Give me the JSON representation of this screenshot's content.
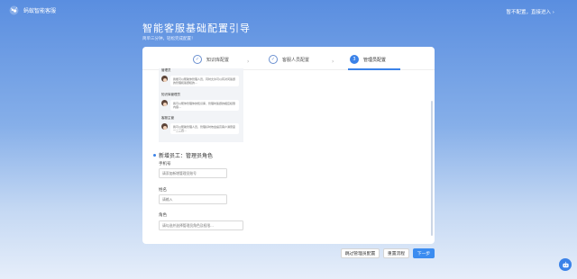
{
  "app": {
    "brand_name": "蚂蚁智能客服",
    "skip_link": "暂不配置，直接进入 ›"
  },
  "header": {
    "title": "智能客服基础配置引导",
    "subtitle": "简单三分钟，轻松完成配置！"
  },
  "steps": [
    {
      "label": "知识库配置",
      "status": "done",
      "marker": "✓"
    },
    {
      "label": "客服人员配置",
      "status": "done",
      "marker": "✓"
    },
    {
      "label": "管理员配置",
      "status": "active",
      "marker": "3"
    }
  ],
  "preview": {
    "items": [
      {
        "role": "管理员",
        "text": "我能可以帮助你管理人员，同时允许可以有对问答题的管理和答题权的..."
      },
      {
        "role": "知识库管理员",
        "text": "我可以帮你管理你的知识库，管理时答题的相应权限内容..."
      },
      {
        "role": "客服主管",
        "text": "我可以帮助管理人员，管理好时效会提高客户满意度一二三四..."
      }
    ]
  },
  "form": {
    "section_title": "新增员工：管理员角色",
    "phone_label": "手机号",
    "phone_placeholder": "请添加新增管理员账号",
    "name_label": "姓名",
    "name_placeholder": "请输入",
    "role_label": "角色",
    "role_placeholder": "请勾选并选择管理员角色及权限..."
  },
  "buttons": {
    "skip_admin": "跳过管理员配置",
    "reset": "重置流程",
    "next": "下一步"
  },
  "colors": {
    "accent": "#3b82e8",
    "background_top": "#5a8ee0"
  }
}
